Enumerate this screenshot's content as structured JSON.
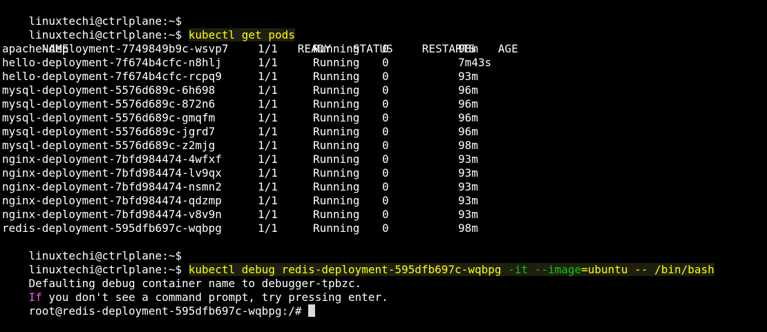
{
  "prompt": "linuxtechi@ctrlplane:~$",
  "cmd_get_pods": "kubectl get pods",
  "table": {
    "headers": [
      "NAME",
      "READY",
      "STATUS",
      "RESTARTS",
      "AGE"
    ],
    "rows": [
      [
        "apache-deployment-7749849b9c-wsvp7",
        "1/1",
        "Running",
        "0",
        "98m"
      ],
      [
        "hello-deployment-7f674b4cfc-n8hlj",
        "1/1",
        "Running",
        "0",
        "7m43s"
      ],
      [
        "hello-deployment-7f674b4cfc-rcpq9",
        "1/1",
        "Running",
        "0",
        "93m"
      ],
      [
        "mysql-deployment-5576d689c-6h698",
        "1/1",
        "Running",
        "0",
        "96m"
      ],
      [
        "mysql-deployment-5576d689c-872n6",
        "1/1",
        "Running",
        "0",
        "96m"
      ],
      [
        "mysql-deployment-5576d689c-gmqfm",
        "1/1",
        "Running",
        "0",
        "96m"
      ],
      [
        "mysql-deployment-5576d689c-jgrd7",
        "1/1",
        "Running",
        "0",
        "96m"
      ],
      [
        "mysql-deployment-5576d689c-z2mjg",
        "1/1",
        "Running",
        "0",
        "98m"
      ],
      [
        "nginx-deployment-7bfd984474-4wfxf",
        "1/1",
        "Running",
        "0",
        "93m"
      ],
      [
        "nginx-deployment-7bfd984474-lv9qx",
        "1/1",
        "Running",
        "0",
        "93m"
      ],
      [
        "nginx-deployment-7bfd984474-nsmn2",
        "1/1",
        "Running",
        "0",
        "93m"
      ],
      [
        "nginx-deployment-7bfd984474-qdzmp",
        "1/1",
        "Running",
        "0",
        "93m"
      ],
      [
        "nginx-deployment-7bfd984474-v8v9n",
        "1/1",
        "Running",
        "0",
        "93m"
      ],
      [
        "redis-deployment-595dfb697c-wqbpg",
        "1/1",
        "Running",
        "0",
        "98m"
      ]
    ]
  },
  "cmd_debug": {
    "base": "kubectl debug redis-deployment-595dfb697c-wqbpg",
    "flag_it": "-it",
    "dashes": "--",
    "image_key": "image",
    "image_eq": "=",
    "image_val": "ubuntu",
    "sep": "--",
    "shell": "/bin/bash"
  },
  "output": {
    "defaulting": "Defaulting debug container name to debugger-tpbzc.",
    "if_word": "If",
    "if_rest": " you don't see a command prompt, try pressing enter.",
    "root_prompt": "root@redis-deployment-595dfb697c-wqbpg:/#"
  },
  "colors": {
    "background": "#000000",
    "command": "#ffff00",
    "if_keyword": "#ff4dff",
    "flag": "#00d000"
  }
}
